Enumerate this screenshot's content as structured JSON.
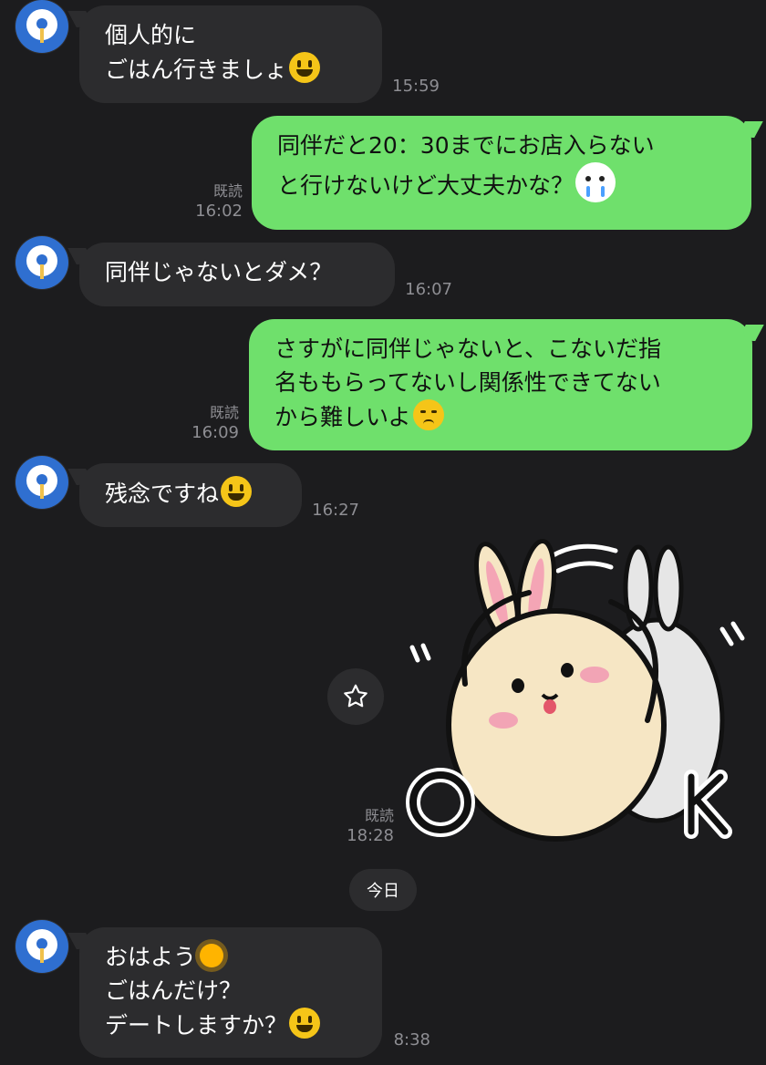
{
  "messages": [
    {
      "from": "them",
      "text": "個人的に\nごはん行きましょ",
      "emoji": "grinning-face",
      "time": "15:59"
    },
    {
      "from": "me",
      "text": "同伴だと20：30までにお店入らない\nと行けないけど大丈夫かな？",
      "emoji": "crying-bunny-sticker-emoji",
      "read": "既読",
      "time": "16:02"
    },
    {
      "from": "them",
      "text": "同伴じゃないとダメ？",
      "time": "16:07"
    },
    {
      "from": "me",
      "text": "さすがに同伴じゃないと、こないだ指\n名ももらってないし関係性できてない\nから難しいよ",
      "emoji": "disappointed-face",
      "read": "既読",
      "time": "16:09"
    },
    {
      "from": "them",
      "text": "残念ですね",
      "emoji": "grinning-face",
      "time": "16:27"
    },
    {
      "from": "me",
      "type": "sticker",
      "sticker_text_left": "O",
      "sticker_text_right": "K",
      "sticker_name": "bunny-ok-sticker",
      "read": "既読",
      "time": "18:28"
    },
    {
      "from": "them",
      "line1": "おはよう",
      "line1_emoji": "sun",
      "line2": "ごはんだけ？",
      "line3": "デートしますか？",
      "line3_emoji": "grinning-face",
      "time": "8:38"
    }
  ],
  "date_separator": "今日",
  "icons": {
    "favorite": "star-icon",
    "avatar": "lightbulb-avatar"
  },
  "colors": {
    "background": "#1c1c1e",
    "incoming": "#2c2c2e",
    "outgoing": "#6fe06c",
    "meta": "#8e8e93"
  }
}
